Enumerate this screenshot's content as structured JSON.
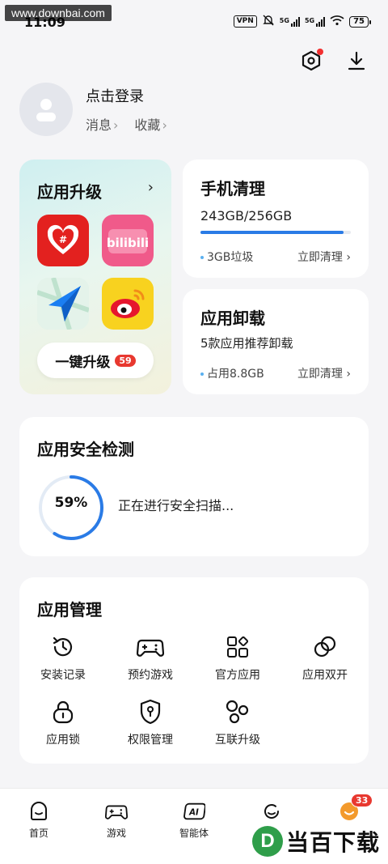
{
  "status_bar": {
    "watermark": "www.downbai.com",
    "time": "11:09",
    "vpn": "VPN",
    "sig1": "5G",
    "sig2": "5G",
    "battery": "75"
  },
  "top_actions": {
    "settings_icon": "hexagon-settings-icon",
    "download_icon": "download-icon",
    "has_notification": true
  },
  "profile": {
    "login": "点击登录",
    "messages": "消息",
    "favorites": "收藏"
  },
  "upgrade_card": {
    "title": "应用升级",
    "apps": [
      {
        "name": "pinduoduo-icon",
        "bg": "#e3211f"
      },
      {
        "name": "bilibili-icon",
        "bg": "#f05a8a",
        "label": "bilibili"
      },
      {
        "name": "maps-icon",
        "bg": "#d9f0e2"
      },
      {
        "name": "weibo-icon",
        "bg": "#f8d21f"
      }
    ],
    "button": "一键升级",
    "badge": "59"
  },
  "clean_card": {
    "title": "手机清理",
    "storage": "243GB/256GB",
    "used_fraction": 0.95,
    "junk": "3GB垃圾",
    "action": "立即清理"
  },
  "uninstall_card": {
    "title": "应用卸载",
    "sub": "5款应用推荐卸载",
    "usage": "占用8.8GB",
    "action": "立即清理"
  },
  "security_card": {
    "title": "应用安全检测",
    "progress": "59%",
    "progress_value": 0.59,
    "status": "正在进行安全扫描..."
  },
  "manage_card": {
    "title": "应用管理",
    "items": [
      {
        "label": "安装记录",
        "icon": "history-icon"
      },
      {
        "label": "预约游戏",
        "icon": "gamepad-icon"
      },
      {
        "label": "官方应用",
        "icon": "apps-grid-icon"
      },
      {
        "label": "应用双开",
        "icon": "dual-app-icon"
      },
      {
        "label": "应用锁",
        "icon": "lock-icon"
      },
      {
        "label": "权限管理",
        "icon": "shield-permission-icon"
      },
      {
        "label": "互联升级",
        "icon": "connected-icon"
      }
    ]
  },
  "bottom_nav": {
    "items": [
      {
        "label": "首页",
        "icon": "home-icon"
      },
      {
        "label": "游戏",
        "icon": "gamepad-icon"
      },
      {
        "label": "智能体",
        "icon": "ai-icon"
      },
      {
        "label": "",
        "icon": "refresh-icon"
      },
      {
        "label": "",
        "icon": "me-icon",
        "badge": "33"
      }
    ]
  },
  "brand": {
    "logo": "D",
    "text": "当百下载"
  },
  "colors": {
    "accent": "#2a7be6",
    "badge": "#e8382f",
    "background": "#f5f5f7"
  }
}
